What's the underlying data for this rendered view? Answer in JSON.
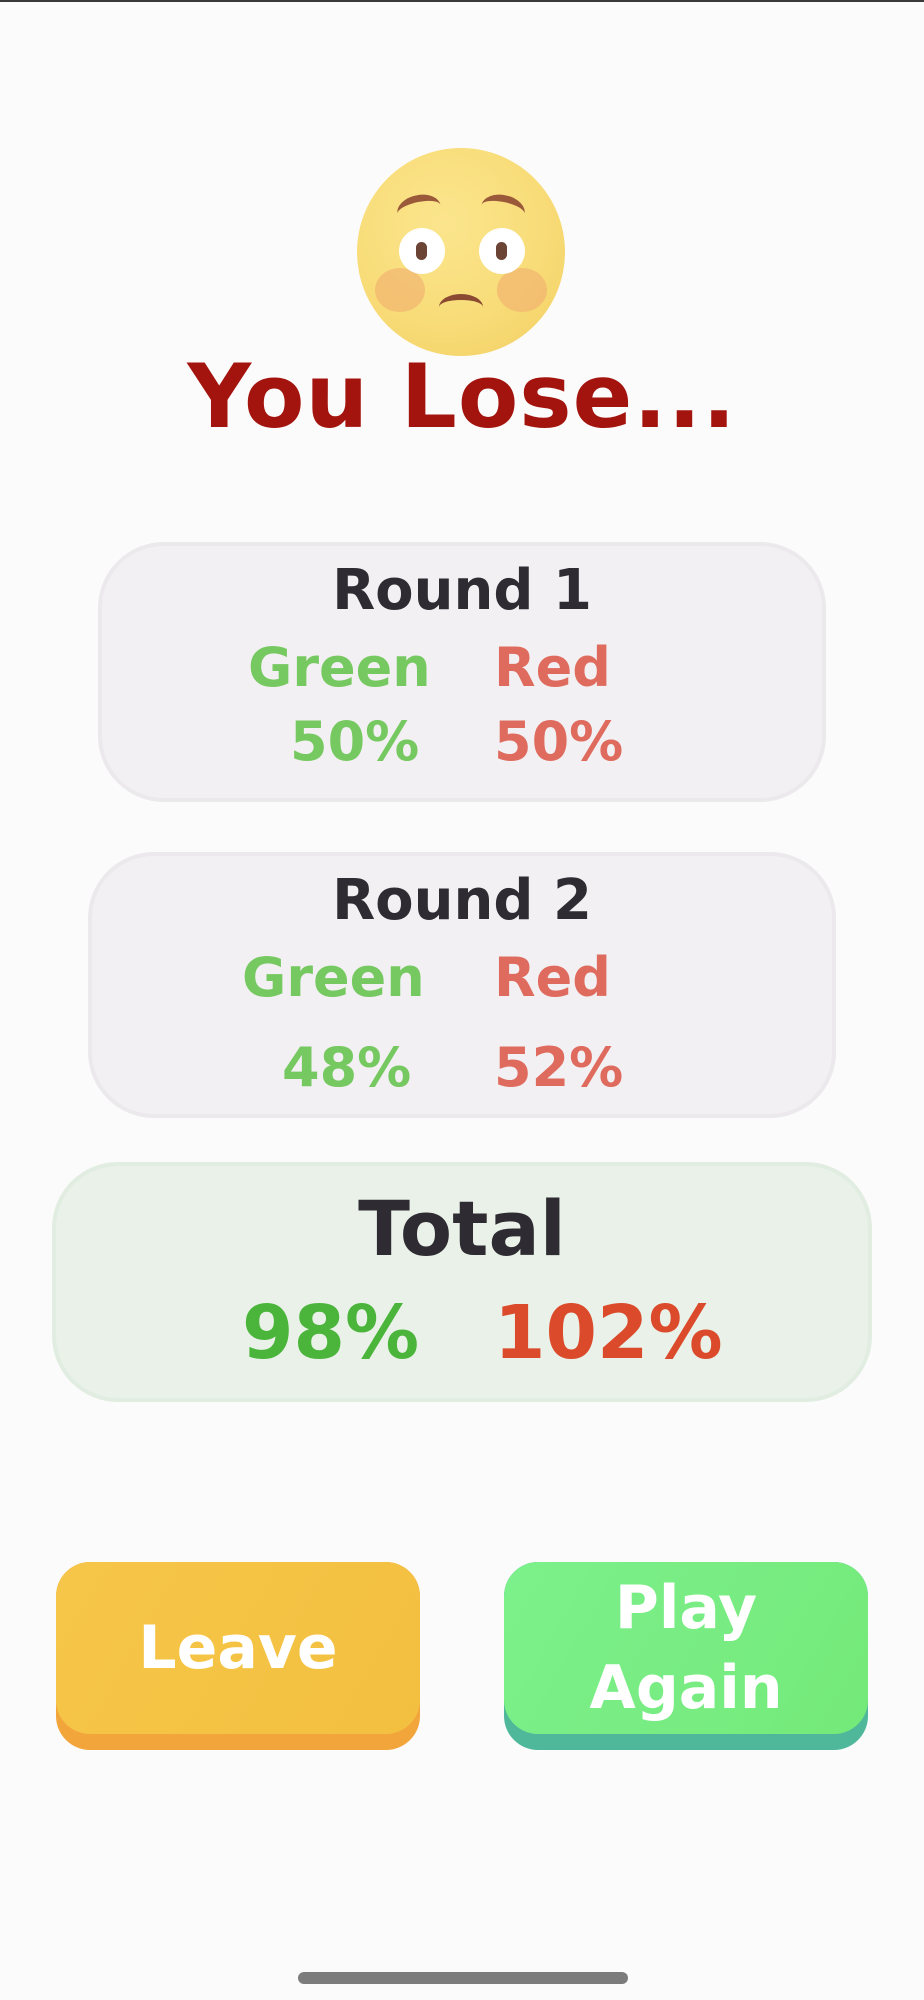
{
  "result": {
    "title": "You Lose..."
  },
  "rounds": [
    {
      "title": "Round 1",
      "green_label": "Green",
      "red_label": "Red",
      "green_value": "50%",
      "red_value": "50%"
    },
    {
      "title": "Round 2",
      "green_label": "Green",
      "red_label": "Red",
      "green_value": "48%",
      "red_value": "52%"
    }
  ],
  "total": {
    "title": "Total",
    "green_value": "98%",
    "red_value": "102%"
  },
  "buttons": {
    "leave": "Leave",
    "play_again_line1": "Play",
    "play_again_line2": "Again"
  },
  "colors": {
    "title": "#a4140e",
    "green": "#76c860",
    "red": "#df6b5e",
    "total_green": "#4ab53a",
    "total_red": "#db4a2a",
    "leave": "#f5c445",
    "play_again": "#79ed84"
  },
  "icons": {
    "result_emoji": "worried-face-icon"
  }
}
